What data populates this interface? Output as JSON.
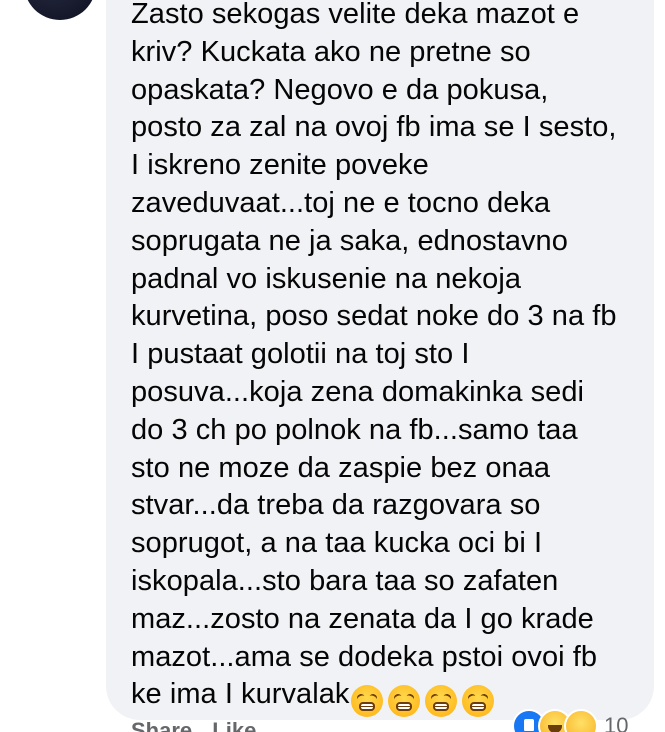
{
  "comment": {
    "lines": [
      "Zasto sekogas velite deka mazot e",
      "kriv? Kuckata ako ne pretne so",
      "opaskata? Negovo e da pokusa,",
      "posto za zal na ovoj fb ima se I sesto,",
      "I iskreno zenite poveke",
      "zaveduvaat...toj ne e tocno deka",
      "soprugata ne ja saka, ednostavno",
      "padnal vo iskusenie na nekoja",
      "kurvetina, poso sedat noke do 3 na fb",
      "I pustaat golotii na toj sto I",
      "posuva...koja zena domakinka sedi",
      "do 3 ch po polnok na fb...samo taa",
      "sto ne moze da zaspie bez onaa",
      "stvar...da treba da razgovara so",
      "soprugot, a na taa kucka oci bi I",
      "iskopala...sto bara taa so zafaten",
      "maz...zosto na zenata da I go krade",
      "mazot...ama se dodeka pstoi ovoi fb",
      "ke ima I kurvalak"
    ],
    "trailing_emojis": [
      "tired-face-emoji",
      "tired-face-emoji",
      "tired-face-emoji",
      "tired-face-emoji"
    ]
  },
  "actions": {
    "share_label": "Share",
    "like_label": "Like"
  },
  "reactions": {
    "count": "10",
    "icons": [
      "like-icon",
      "laugh-icon",
      "sad-icon"
    ]
  },
  "colors": {
    "bubble_bg": "#f0f2f5",
    "text": "#050505",
    "secondary": "#65676b",
    "like_blue": "#1877f2"
  }
}
